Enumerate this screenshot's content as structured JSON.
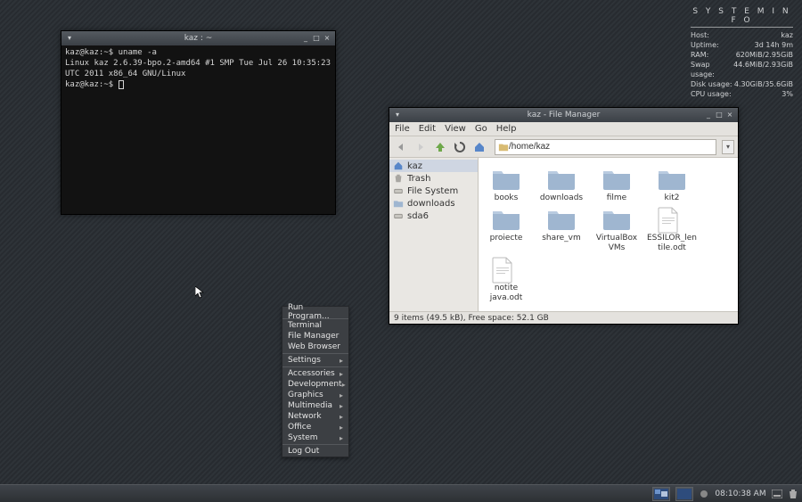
{
  "sysinfo": {
    "title": "S Y S T E M   I N F O",
    "rows": [
      {
        "label": "Host:",
        "value": "kaz"
      },
      {
        "label": "Uptime:",
        "value": "3d 14h 9m"
      },
      {
        "label": "RAM:",
        "value": "620MiB/2.95GiB"
      },
      {
        "label": "Swap usage:",
        "value": "44.6MiB/2.93GiB"
      },
      {
        "label": "Disk usage:",
        "value": "4.30GiB/35.6GiB"
      },
      {
        "label": "CPU usage:",
        "value": "3%"
      }
    ]
  },
  "terminal": {
    "title": "kaz : ~",
    "prompt1": "kaz@kaz:~$ ",
    "cmd1": "uname -a",
    "output": "Linux kaz 2.6.39-bpo.2-amd64 #1 SMP Tue Jul 26 10:35:23 UTC 2011 x86_64 GNU/Linux",
    "prompt2": "kaz@kaz:~$ "
  },
  "fm": {
    "title": "kaz - File Manager",
    "menubar": [
      "File",
      "Edit",
      "View",
      "Go",
      "Help"
    ],
    "location": "/home/kaz",
    "sidebar": [
      {
        "label": "kaz",
        "icon": "home",
        "selected": true
      },
      {
        "label": "Trash",
        "icon": "trash"
      },
      {
        "label": "File System",
        "icon": "drive"
      },
      {
        "label": "downloads",
        "icon": "folder"
      },
      {
        "label": "sda6",
        "icon": "drive"
      }
    ],
    "files": [
      {
        "label": "books",
        "type": "folder"
      },
      {
        "label": "downloads",
        "type": "folder"
      },
      {
        "label": "filme",
        "type": "folder"
      },
      {
        "label": "kit2",
        "type": "folder"
      },
      {
        "label": "proiecte",
        "type": "folder"
      },
      {
        "label": "share_vm",
        "type": "folder"
      },
      {
        "label": "VirtualBox VMs",
        "type": "folder"
      },
      {
        "label": "ESSILOR_lentile.odt",
        "type": "doc"
      },
      {
        "label": "notite java.odt",
        "type": "doc"
      }
    ],
    "status": "9 items (49.5 kB), Free space: 52.1 GB"
  },
  "ctx": {
    "items": [
      {
        "label": "Run Program...",
        "sub": false
      },
      {
        "sep": true
      },
      {
        "label": "Terminal",
        "sub": false
      },
      {
        "label": "File Manager",
        "sub": false
      },
      {
        "label": "Web Browser",
        "sub": false
      },
      {
        "sep": true
      },
      {
        "label": "Settings",
        "sub": true
      },
      {
        "sep": true
      },
      {
        "label": "Accessories",
        "sub": true
      },
      {
        "label": "Development",
        "sub": true
      },
      {
        "label": "Graphics",
        "sub": true
      },
      {
        "label": "Multimedia",
        "sub": true
      },
      {
        "label": "Network",
        "sub": true
      },
      {
        "label": "Office",
        "sub": true
      },
      {
        "label": "System",
        "sub": true
      },
      {
        "sep": true
      },
      {
        "label": "Log Out",
        "sub": false
      }
    ]
  },
  "taskbar": {
    "workspaces": 2,
    "clock": "08:10:38 AM"
  }
}
